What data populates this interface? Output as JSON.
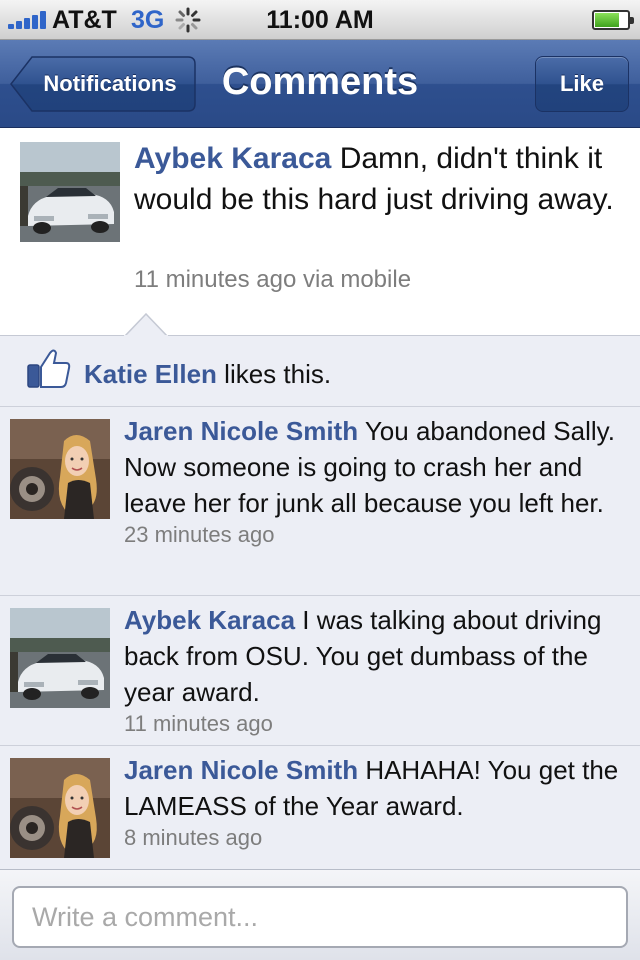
{
  "status_bar": {
    "carrier": "AT&T",
    "network": "3G",
    "time": "11:00 AM",
    "battery_level": 0.7
  },
  "nav": {
    "back_label": "Notifications",
    "title": "Comments",
    "like_label": "Like"
  },
  "post": {
    "author": "Aybek Karaca",
    "text": "Damn, didn't think it would be this hard just driving away.",
    "meta": "11 minutes ago via mobile",
    "avatar_icon": "car-photo"
  },
  "likes": {
    "name": "Katie Ellen",
    "suffix": "likes this."
  },
  "comments": [
    {
      "author": "Jaren Nicole Smith",
      "text": "You abandoned Sally. Now someone is going to crash her and leave her for junk all because you left her.",
      "time": "23 minutes ago",
      "avatar_icon": "person-photo"
    },
    {
      "author": "Aybek Karaca",
      "text": "I was talking about driving back from OSU. You get dumbass of the year award.",
      "time": "11 minutes ago",
      "avatar_icon": "car-photo"
    },
    {
      "author": "Jaren Nicole Smith",
      "text": "HAHAHA! You get the LAMEASS of the Year award.",
      "time": "8 minutes ago",
      "avatar_icon": "person-photo"
    }
  ],
  "footer": {
    "placeholder": "Write a comment..."
  },
  "colors": {
    "nav_blue": "#3f5f9c",
    "author_blue": "#3b5998",
    "background": "#eceef5"
  }
}
